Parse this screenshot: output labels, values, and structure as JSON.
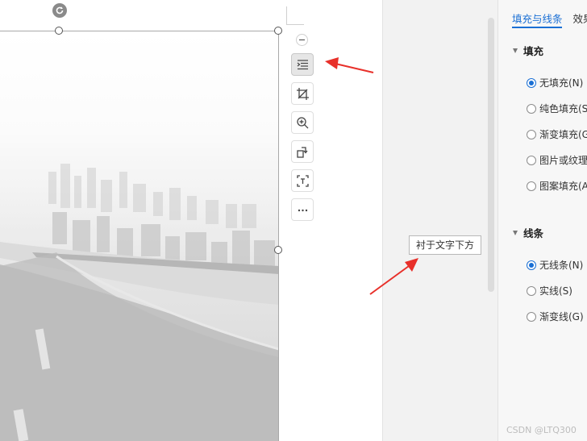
{
  "tooltip": {
    "text": "衬于文字下方"
  },
  "toolbar": {
    "items": [
      {
        "icon": "wrap-text-icon",
        "active": true
      },
      {
        "icon": "crop-icon",
        "active": false
      },
      {
        "icon": "zoom-in-icon",
        "active": false
      },
      {
        "icon": "rotate-image-icon",
        "active": false
      },
      {
        "icon": "extract-text-icon",
        "active": false
      },
      {
        "icon": "more-icon",
        "active": false
      }
    ]
  },
  "panel": {
    "tabs": [
      "填充与线条",
      "效果"
    ],
    "active_tab": "填充与线条",
    "fill": {
      "title": "填充",
      "options": [
        {
          "label": "无填充(N)",
          "checked": true
        },
        {
          "label": "纯色填充(S)",
          "checked": false
        },
        {
          "label": "渐变填充(G)",
          "checked": false
        },
        {
          "label": "图片或纹理填充(P)",
          "checked": false
        },
        {
          "label": "图案填充(A)",
          "checked": false
        }
      ]
    },
    "line": {
      "title": "线条",
      "options": [
        {
          "label": "无线条(N)",
          "checked": true
        },
        {
          "label": "实线(S)",
          "checked": false
        },
        {
          "label": "渐变线(G)",
          "checked": false
        }
      ]
    }
  },
  "watermark": "CSDN @LTQ300",
  "colors": {
    "accent": "#1a6fd4",
    "annotation_arrow": "#e8302a"
  }
}
